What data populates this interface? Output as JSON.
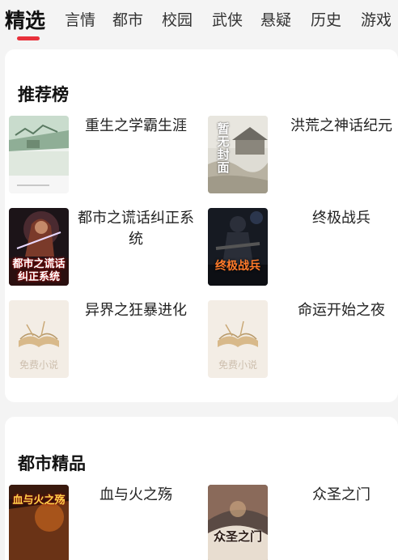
{
  "tabs": [
    {
      "label": "精选",
      "active": true
    },
    {
      "label": "言情"
    },
    {
      "label": "都市"
    },
    {
      "label": "校园"
    },
    {
      "label": "武侠"
    },
    {
      "label": "悬疑"
    },
    {
      "label": "历史"
    },
    {
      "label": "游戏"
    }
  ],
  "sections": [
    {
      "title": "推荐榜",
      "books": [
        {
          "title": "重生之学霸生涯"
        },
        {
          "title": "洪荒之神话纪元"
        },
        {
          "title": "都市之谎话纠正系统"
        },
        {
          "title": "终极战兵"
        },
        {
          "title": "异界之狂暴进化"
        },
        {
          "title": "命运开始之夜"
        }
      ]
    },
    {
      "title": "都市精品",
      "books": [
        {
          "title": "血与火之殇"
        },
        {
          "title": "众圣之门"
        }
      ]
    }
  ],
  "placeholder_cover_text": "免费小说",
  "colors": {
    "accent": "#e8313b"
  }
}
